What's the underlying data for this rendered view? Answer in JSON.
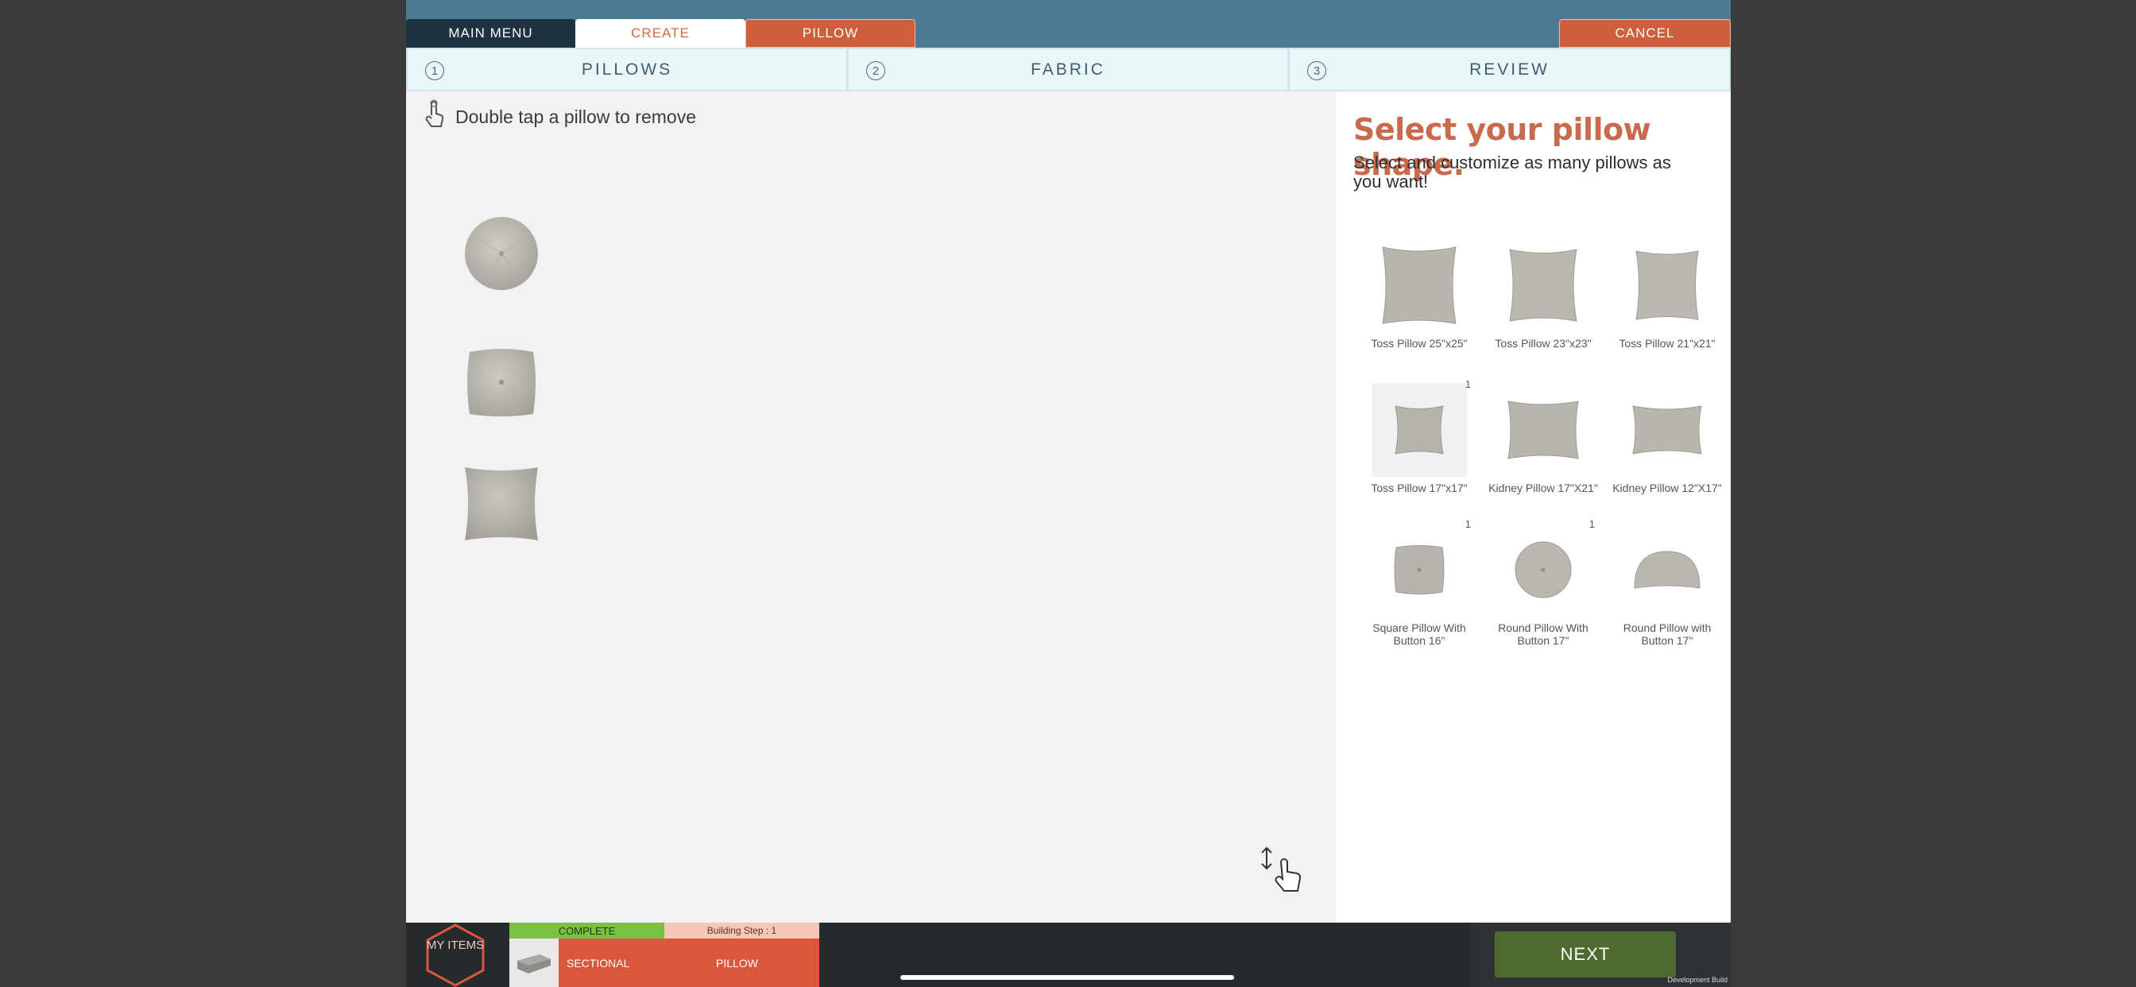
{
  "header": {
    "main_menu": "MAIN MENU",
    "create": "CREATE",
    "pillow": "PILLOW",
    "cancel": "CANCEL"
  },
  "steps": [
    {
      "num": "1",
      "label": "PILLOWS"
    },
    {
      "num": "2",
      "label": "FABRIC"
    },
    {
      "num": "3",
      "label": "REVIEW"
    }
  ],
  "canvas": {
    "hint": "Double tap a pillow to remove",
    "placed_pillows": [
      "round-pillow",
      "square-button-pillow",
      "toss-pillow"
    ]
  },
  "panel": {
    "title": "Select your pillow shape.",
    "subtitle": "Select and customize as many pillows as you want!",
    "items": [
      {
        "label": "Toss Pillow 25\"x25\"",
        "count": ""
      },
      {
        "label": "Toss Pillow 23\"x23\"",
        "count": ""
      },
      {
        "label": "Toss Pillow 21\"x21\"",
        "count": ""
      },
      {
        "label": "Toss Pillow 17\"x17\"",
        "count": "1",
        "selected": true
      },
      {
        "label": "Kidney Pillow 17\"X21\"",
        "count": ""
      },
      {
        "label": "Kidney Pillow 12\"X17\"",
        "count": ""
      },
      {
        "label": "Square Pillow With Button 16\"",
        "count": "1"
      },
      {
        "label": "Round Pillow With Button 17\"",
        "count": "1"
      },
      {
        "label": "Round Pillow with Button 17\"",
        "count": ""
      }
    ]
  },
  "bottom": {
    "my_items": "MY ITEMS",
    "complete": "COMPLETE",
    "building_step": "Building Step : 1",
    "sectional": "SECTIONAL",
    "pillow": "PILLOW",
    "next": "NEXT",
    "dev_build": "Development Build"
  },
  "colors": {
    "header_bg": "#4e7a93",
    "accent": "#cf5f3c",
    "main_menu_bg": "#1d3341",
    "next_bg": "#4d6b2f",
    "complete_bg": "#7bc043"
  }
}
